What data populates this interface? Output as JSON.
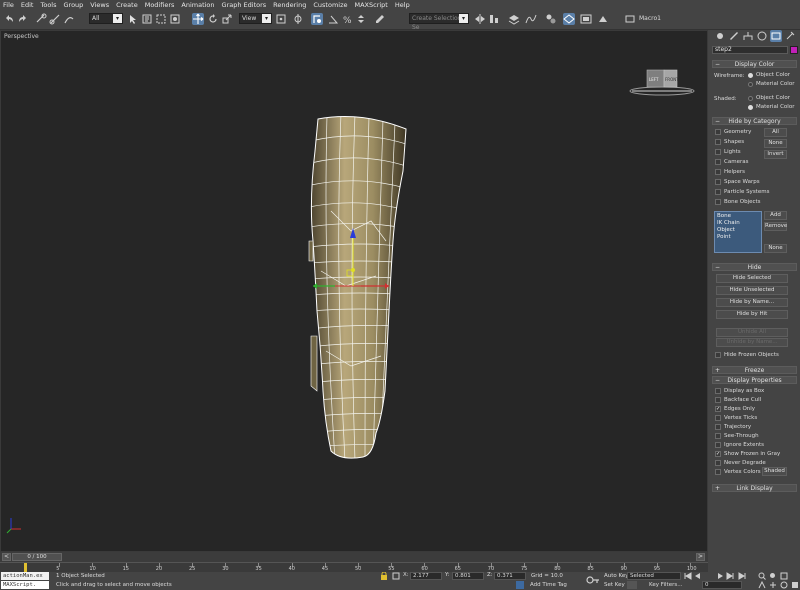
{
  "menu": [
    "File",
    "Edit",
    "Tools",
    "Group",
    "Views",
    "Create",
    "Modifiers",
    "Animation",
    "Graph Editors",
    "Rendering",
    "Customize",
    "MAXScript",
    "Help"
  ],
  "toolbar": {
    "filter_value": "All",
    "refcoord_value": "View",
    "selection_set_placeholder": "Create Selection Se",
    "macro_label": "Macro1"
  },
  "viewport": {
    "label": "Perspective",
    "viewcube_left": "LEFT",
    "viewcube_front": "FRONT"
  },
  "panel": {
    "object_name": "step2",
    "display_color": {
      "title": "Display Color",
      "wireframe_label": "Wireframe:",
      "shaded_label": "Shaded:",
      "object_color": "Object Color",
      "material_color": "Material Color"
    },
    "hide_by_category": {
      "title": "Hide by Category",
      "items": [
        "Geometry",
        "Shapes",
        "Lights",
        "Cameras",
        "Helpers",
        "Space Warps",
        "Particle Systems",
        "Bone Objects"
      ],
      "all": "All",
      "none": "None",
      "invert": "Invert",
      "list": [
        "Bone",
        "IK Chain Object",
        "Point"
      ],
      "add": "Add",
      "remove": "Remove",
      "none2": "None"
    },
    "hide": {
      "title": "Hide",
      "buttons": [
        "Hide Selected",
        "Hide Unselected",
        "Hide by Name...",
        "Hide by Hit"
      ],
      "unhide_all": "Unhide All",
      "unhide_by_name": "Unhide by Name...",
      "hide_frozen": "Hide Frozen Objects"
    },
    "freeze": {
      "title": "Freeze"
    },
    "display_properties": {
      "title": "Display Properties",
      "items": [
        {
          "label": "Display as Box",
          "checked": false
        },
        {
          "label": "Backface Cull",
          "checked": false
        },
        {
          "label": "Edges Only",
          "checked": true
        },
        {
          "label": "Vertex Ticks",
          "checked": false
        },
        {
          "label": "Trajectory",
          "checked": false
        },
        {
          "label": "See-Through",
          "checked": false
        },
        {
          "label": "Ignore Extents",
          "checked": false
        },
        {
          "label": "Show Frozen in Gray",
          "checked": true
        },
        {
          "label": "Never Degrade",
          "checked": false
        },
        {
          "label": "Vertex Colors",
          "checked": false
        }
      ],
      "shaded_btn": "Shaded"
    },
    "link_display": {
      "title": "Link Display"
    }
  },
  "timeline": {
    "frame_readout": "0 / 100",
    "ticks": [
      "5",
      "10",
      "15",
      "20",
      "25",
      "30",
      "35",
      "40",
      "45",
      "50",
      "55",
      "60",
      "65",
      "70",
      "75",
      "80",
      "85",
      "90",
      "95",
      "100"
    ]
  },
  "status": {
    "listener_top": "actionMan.ex",
    "listener_bottom": "MAXScript.",
    "selected_text": "1 Object Selected",
    "prompt_text": "Click and drag to select and move objects",
    "x_label": "X:",
    "x_value": "2.177",
    "y_label": "Y:",
    "y_value": "0.801",
    "z_label": "Z:",
    "z_value": "0.371",
    "grid_text": "Grid = 10.0",
    "add_time_tag": "Add Time Tag",
    "auto_key": "Auto Key",
    "set_key": "Set Key",
    "selected_dropdown": "Selected",
    "key_filters": "Key Filters...",
    "frame_field": "0"
  }
}
